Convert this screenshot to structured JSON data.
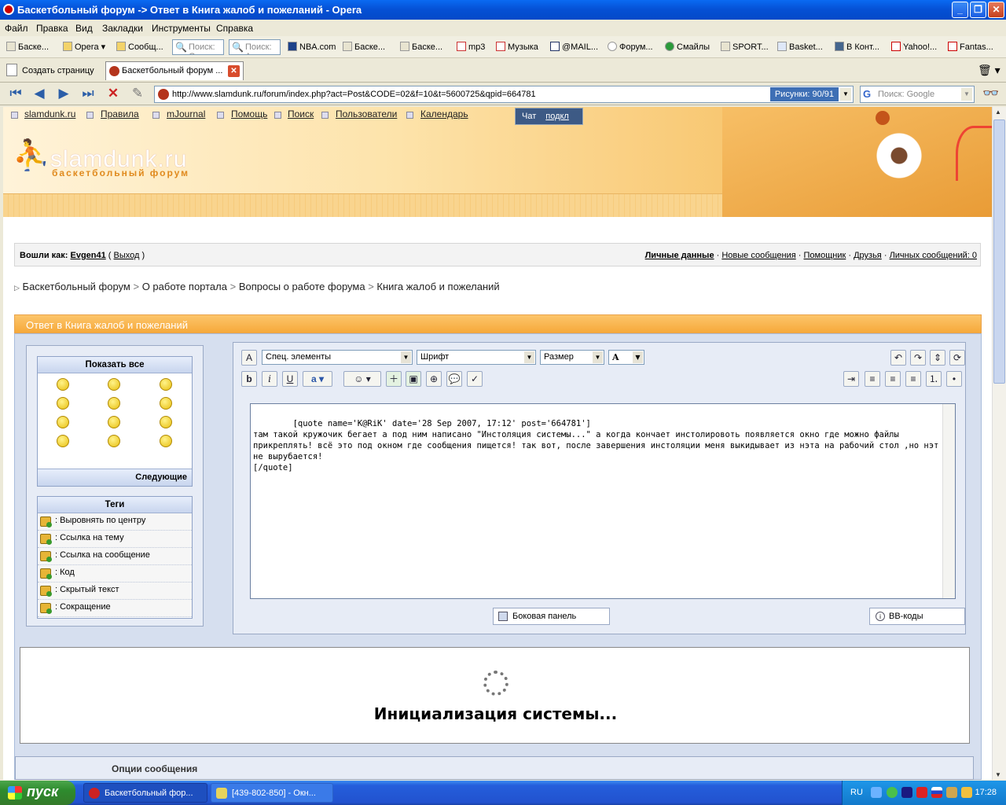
{
  "window": {
    "title": "Баскетбольный форум -> Ответ в Книга жалоб и пожеланий - Opera"
  },
  "menu": [
    "Файл",
    "Правка",
    "Вид",
    "Закладки",
    "Инструменты",
    "Справка"
  ],
  "bookmarks": {
    "items": [
      "Баске...",
      "Opera",
      "Сообщ...",
      "NBA.com",
      "Баске...",
      "Баске...",
      "mp3",
      "Музыка",
      "@MAIL...",
      "Форум...",
      "Смайлы",
      "SPORT...",
      "Basket...",
      "В Конт...",
      "Yahoo!...",
      "Fantas..."
    ],
    "search1_placeholder": "Поиск: G",
    "search2_placeholder": "Поиск: A"
  },
  "tabs": {
    "new_tab": "Создать страницу",
    "active": "Баскетбольный форум ..."
  },
  "address": {
    "url": "http://www.slamdunk.ru/forum/index.php?act=Post&CODE=02&f=10&t=5600725&qpid=664781",
    "images": "Рисунки:  90/91",
    "search_placeholder": "Поиск: Google"
  },
  "forum": {
    "toplinks": [
      "slamdunk.ru",
      "Правила",
      "mJournal",
      "Помощь",
      "Поиск",
      "Пользователи",
      "Календарь"
    ],
    "chat_label": "Чат",
    "chat_link": "подкл",
    "logo": "slamdunk.ru",
    "logo_sub": "баскетбольный форум",
    "login_prefix": "Вошли как:",
    "username": "Evgen41",
    "logout": "Выход",
    "user_links": [
      "Личные данные",
      "Новые сообщения",
      "Помощник",
      "Друзья",
      "Личных сообщений: 0"
    ],
    "breadcrumb": [
      "Баскетбольный форум",
      "О работе портала",
      "Вопросы о работе форума",
      "Книга жалоб и пожеланий"
    ],
    "reply_title": "Ответ в Книга жалоб и пожеланий",
    "smilies_title": "Показать все",
    "smilies_next": "Следующие",
    "tags_title": "Теги",
    "tags": [
      ": Выровнять по центру",
      ": Ссылка на тему",
      ": Ссылка на сообщение",
      ": Код",
      ": Скрытый текст",
      ": Сокращение"
    ],
    "editor": {
      "special": "Спец. элементы",
      "font": "Шрифт",
      "size": "Размер",
      "text": "[quote name='K@RiK' date='28 Sep 2007, 17:12' post='664781']\nтам такой кружочик бегает а под ним написано \"Инстоляция системы...\" а когда кончает инстолировоть появляется окно где можно файлы прикреплять! всё это под окном где сообщения пищется! так вот, после завершения инстоляции меня выкидывает из нэта на рабочий стол ,но нэт не вырубается!\n[/quote]",
      "side_panel": "Боковая панель",
      "bb_codes": "BB-коды"
    },
    "init_text": "Инициализация системы...",
    "options_title": "Опции сообщения"
  },
  "taskbar": {
    "start": "пуск",
    "tasks": [
      "Баскетбольный фор...",
      "[439-802-850] - Окн..."
    ],
    "lang": "RU",
    "clock": "17:28"
  }
}
